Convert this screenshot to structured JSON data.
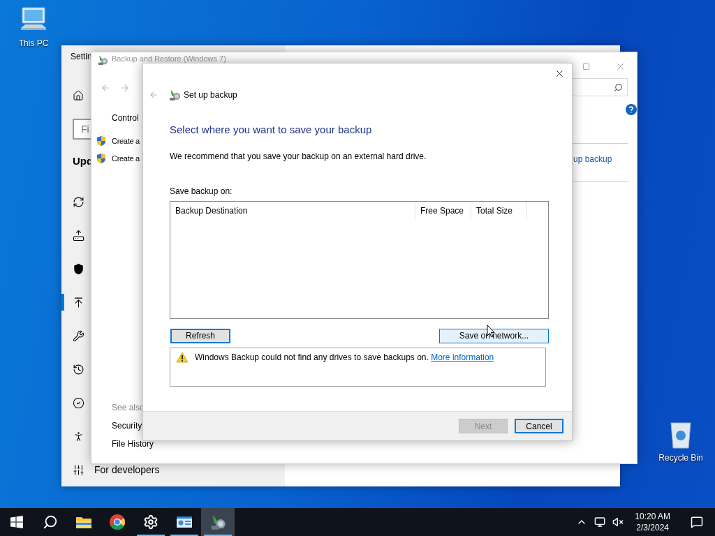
{
  "desktop_icons": [
    {
      "kind": "computer",
      "label": "This PC"
    },
    {
      "kind": "bin",
      "label": "Recycle Bin"
    }
  ],
  "settings_window": {
    "title": "Settin",
    "search_placeholder": "Fi",
    "heading": "Upd",
    "nav_items": [
      {
        "kind": "sync",
        "selected": false
      },
      {
        "kind": "delivery",
        "selected": false
      },
      {
        "kind": "shield",
        "selected": false
      },
      {
        "kind": "upload",
        "selected": true
      },
      {
        "kind": "wrench",
        "selected": false
      },
      {
        "kind": "recovery",
        "selected": false
      },
      {
        "kind": "activation",
        "selected": false
      },
      {
        "kind": "find",
        "selected": false
      },
      {
        "kind": "developers",
        "selected": false,
        "label": "For developers"
      }
    ]
  },
  "backup_window": {
    "title": "Backup and Restore (Windows 7)",
    "home_link": "Control",
    "tasks": [
      "Create a",
      "Create a"
    ],
    "right_link": "up backup",
    "see_also": {
      "heading": "See also",
      "links": [
        "Security",
        "File History"
      ]
    }
  },
  "dialog": {
    "title": "Set up backup",
    "heading": "Select where you want to save your backup",
    "description": "We recommend that you save your backup on an external hard drive.",
    "list_label": "Save backup on:",
    "columns": [
      "Backup Destination",
      "Free Space",
      "Total Size"
    ],
    "refresh": {
      "label": "Refresh",
      "focused": true,
      "hovered": false,
      "disabled": false
    },
    "network": {
      "label": "Save on network...",
      "focused": false,
      "hovered": true,
      "disabled": false
    },
    "message": {
      "text": "Windows Backup could not find any drives to save backups on.",
      "link": "More information"
    },
    "footer_buttons": [
      {
        "label": "Next",
        "focused": false,
        "hovered": false,
        "disabled": true
      },
      {
        "label": "Cancel",
        "focused": true,
        "hovered": false,
        "disabled": false
      }
    ]
  },
  "taskbar": {
    "apps": [
      {
        "kind": "start",
        "running": false,
        "active": false
      },
      {
        "kind": "search",
        "running": false,
        "active": false
      },
      {
        "kind": "explorer",
        "running": false,
        "active": false
      },
      {
        "kind": "chrome",
        "running": false,
        "active": false
      },
      {
        "kind": "settings",
        "running": true,
        "active": false
      },
      {
        "kind": "panel",
        "running": true,
        "active": false
      },
      {
        "kind": "backup",
        "running": true,
        "active": true
      }
    ],
    "time": "10:20 AM",
    "date": "2/3/2024"
  }
}
